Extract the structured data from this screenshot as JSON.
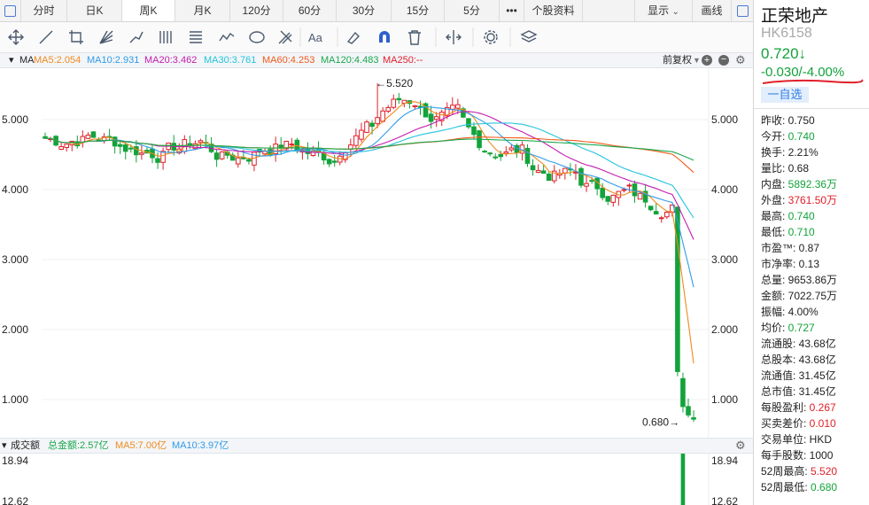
{
  "tabs": [
    {
      "label": "分时",
      "w": 52
    },
    {
      "label": "日K",
      "w": 62
    },
    {
      "label": "周K",
      "w": 60
    },
    {
      "label": "月K",
      "w": 62
    },
    {
      "label": "120分",
      "w": 60
    },
    {
      "label": "60分",
      "w": 60
    },
    {
      "label": "30分",
      "w": 62
    },
    {
      "label": "15分",
      "w": 60
    },
    {
      "label": "5分",
      "w": 62
    },
    {
      "label": "•••",
      "w": 28
    },
    {
      "label": "个股资料",
      "w": 66
    }
  ],
  "active_tab": "周K",
  "display_label": "显示",
  "draw_label": "画线",
  "tool_icons": [
    "move-icon",
    "line-icon",
    "crop-icon",
    "fan-icon",
    "pattern-icon",
    "cycle-icon",
    "channel-icon",
    "wave-icon",
    "ellipse-icon",
    "fork-icon",
    "text-icon",
    "eraser-icon",
    "magnet-icon",
    "trash-icon",
    "split-icon",
    "settings-icon",
    "layers-icon"
  ],
  "ma": {
    "name": "MA",
    "items": [
      {
        "label": "MA5:2.054",
        "color": "#f08a1c"
      },
      {
        "label": "MA10:2.931",
        "color": "#2f9be8"
      },
      {
        "label": "MA20:3.462",
        "color": "#c41cb0"
      },
      {
        "label": "MA30:3.761",
        "color": "#22c4dc"
      },
      {
        "label": "MA60:4.253",
        "color": "#f05a1c"
      },
      {
        "label": "MA120:4.483",
        "color": "#1aa84c"
      },
      {
        "label": "MA250:--",
        "color": "#e0202a"
      }
    ],
    "adjust_label": "前复权"
  },
  "volume": {
    "name": "成交额",
    "items": [
      {
        "label": "总金额:2.57亿",
        "color": "#1aa84c"
      },
      {
        "label": "MA5:7.00亿",
        "color": "#f08a1c"
      },
      {
        "label": "MA10:3.97亿",
        "color": "#2f9be8"
      }
    ],
    "ticks": [
      "18.94",
      "12.62"
    ]
  },
  "chart_data": {
    "type": "candlestick",
    "ylim": [
      0.6,
      5.8
    ],
    "yticks": [
      "5.000",
      "4.000",
      "3.000",
      "2.000",
      "1.000"
    ],
    "yticks_values": [
      5,
      4,
      3,
      2,
      1
    ],
    "max_marker": {
      "label": "←5.520",
      "value": 5.52
    },
    "min_marker": {
      "label": "0.680→",
      "value": 0.68
    }
  },
  "stock": {
    "name": "正荣地产",
    "code": "HK6158",
    "price": "0.720↓",
    "change": "-0.030/-4.00%",
    "watch_label": "一自选"
  },
  "details": [
    {
      "k": "昨收:",
      "v": "0.750",
      "c": "#222"
    },
    {
      "k": "今开:",
      "v": "0.740",
      "c": "#12a33a"
    },
    {
      "k": "换手:",
      "v": "2.21%",
      "c": "#222"
    },
    {
      "k": "量比:",
      "v": "0.68",
      "c": "#222"
    },
    {
      "k": "内盘:",
      "v": "5892.36万",
      "c": "#12a33a"
    },
    {
      "k": "外盘:",
      "v": "3761.50万",
      "c": "#e0202a"
    },
    {
      "k": "最高:",
      "v": "0.740",
      "c": "#12a33a"
    },
    {
      "k": "最低:",
      "v": "0.710",
      "c": "#12a33a"
    },
    {
      "k": "市盈™:",
      "v": "0.87",
      "c": "#222"
    },
    {
      "k": "市净率:",
      "v": "0.13",
      "c": "#222"
    },
    {
      "k": "总量:",
      "v": "9653.86万",
      "c": "#222"
    },
    {
      "k": "金额:",
      "v": "7022.75万",
      "c": "#222"
    },
    {
      "k": "振幅:",
      "v": "4.00%",
      "c": "#222"
    },
    {
      "k": "均价:",
      "v": "0.727",
      "c": "#12a33a"
    },
    {
      "k": "流通股:",
      "v": "43.68亿",
      "c": "#222"
    },
    {
      "k": "总股本:",
      "v": "43.68亿",
      "c": "#222"
    },
    {
      "k": "流通值:",
      "v": "31.45亿",
      "c": "#222"
    },
    {
      "k": "总市值:",
      "v": "31.45亿",
      "c": "#222"
    },
    {
      "k": "每股盈利:",
      "v": "0.267",
      "c": "#e0202a"
    },
    {
      "k": "买卖差价:",
      "v": "0.010",
      "c": "#e0202a"
    },
    {
      "k": "交易单位:",
      "v": "HKD",
      "c": "#222"
    },
    {
      "k": "每手股数:",
      "v": "1000",
      "c": "#222"
    },
    {
      "k": "52周最高:",
      "v": "5.520",
      "c": "#e0202a"
    },
    {
      "k": "52周最低:",
      "v": "0.680",
      "c": "#12a33a"
    }
  ]
}
